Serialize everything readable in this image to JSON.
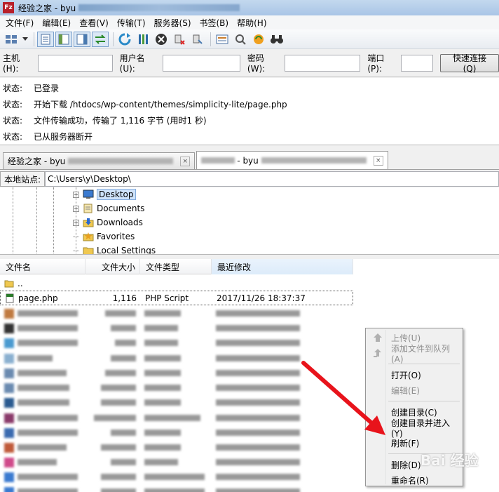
{
  "titlebar": {
    "title_prefix": "经验之家 - byu"
  },
  "menu": [
    "文件(F)",
    "编辑(E)",
    "查看(V)",
    "传输(T)",
    "服务器(S)",
    "书签(B)",
    "帮助(H)"
  ],
  "toolbar": {
    "icons": [
      "site-manager-icon",
      "dropdown-arrow-icon",
      "toggle-log-icon",
      "toggle-local-tree-icon",
      "toggle-remote-tree-icon",
      "toggle-queue-icon",
      "refresh-icon",
      "process-queue-icon",
      "cancel-icon",
      "disconnect-icon",
      "reconnect-icon",
      "filter-icon",
      "compare-icon",
      "sync-browse-icon",
      "search-icon"
    ]
  },
  "quickconnect": {
    "host_label": "主机(H):",
    "user_label": "用户名(U):",
    "pass_label": "密码(W):",
    "port_label": "端口(P):",
    "connect_button": "快速连接(Q)"
  },
  "statuslog": [
    {
      "key": "状态:",
      "text": "已登录"
    },
    {
      "key": "状态:",
      "text": "开始下载 /htdocs/wp-content/themes/simplicity-lite/page.php"
    },
    {
      "key": "状态:",
      "text": "文件传输成功，传输了 1,116 字节 (用时1 秒)"
    },
    {
      "key": "状态:",
      "text": "已从服务器断开"
    }
  ],
  "tabs": [
    {
      "prefix": "经验之家 - byu",
      "close": "×"
    },
    {
      "prefix": "- byu",
      "close": "×"
    }
  ],
  "local": {
    "label": "本地站点:",
    "path": "C:\\Users\\y\\Desktop\\"
  },
  "tree": [
    {
      "label": "Desktop",
      "icon": "desktop-icon",
      "expander": "+"
    },
    {
      "label": "Documents",
      "icon": "documents-icon",
      "expander": "+"
    },
    {
      "label": "Downloads",
      "icon": "downloads-icon",
      "expander": "+"
    },
    {
      "label": "Favorites",
      "icon": "favorites-icon",
      "expander": ""
    },
    {
      "label": "Local Settings",
      "icon": "folder-icon",
      "expander": ""
    }
  ],
  "filelist": {
    "columns": [
      "文件名",
      "文件大小",
      "文件类型",
      "最近修改"
    ],
    "parent": "..",
    "file": {
      "name": "page.php",
      "size": "1,116",
      "type": "PHP Script",
      "date": "2017/11/26 18:37:37"
    }
  },
  "context_menu": {
    "upload": "上传(U)",
    "add_queue": "添加文件到队列(A)",
    "open": "打开(O)",
    "edit": "编辑(E)",
    "mkdir": "创建目录(C)",
    "mkdir_enter": "创建目录并进入(Y)",
    "refresh": "刷新(F)",
    "delete": "删除(D)",
    "rename": "重命名(R)"
  },
  "colors": {
    "accent": "#3399ff",
    "arrow": "#e8131b"
  },
  "watermark": "Bai 经验"
}
